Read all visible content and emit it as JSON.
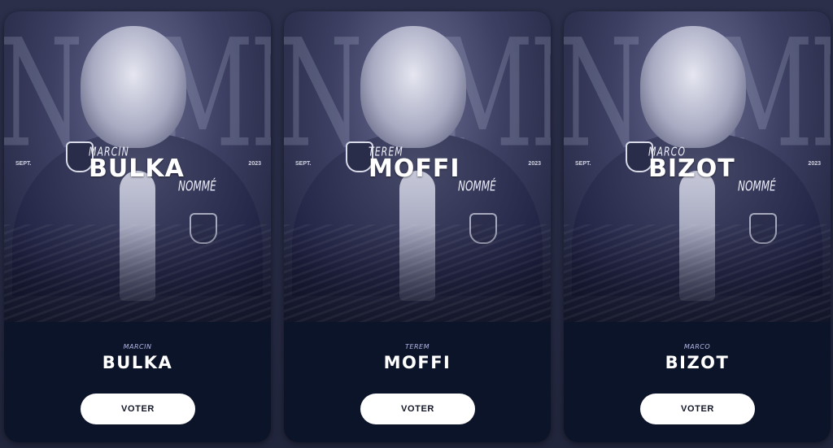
{
  "cards": [
    {
      "poster": {
        "background_word": "NOMMÉ",
        "first_name": "MARCIN",
        "last_name": "BULKA",
        "tag": "NOMMÉ",
        "month": "SEPT.",
        "year": "2023"
      },
      "first_name": "MARCIN",
      "last_name": "BULKA",
      "vote_label": "VOTER"
    },
    {
      "poster": {
        "background_word": "NOMMÉ",
        "first_name": "TEREM",
        "last_name": "MOFFI",
        "tag": "NOMMÉ",
        "month": "SEPT.",
        "year": "2023"
      },
      "first_name": "TEREM",
      "last_name": "MOFFI",
      "vote_label": "VOTER"
    },
    {
      "poster": {
        "background_word": "NOMMÉ",
        "first_name": "MARCO",
        "last_name": "BIZOT",
        "tag": "NOMMÉ",
        "month": "SEPT.",
        "year": "2023"
      },
      "first_name": "MARCO",
      "last_name": "BIZOT",
      "vote_label": "VOTER"
    }
  ],
  "colors": {
    "page_background": "#262a42",
    "card_background": "#0c1429",
    "first_name_accent": "#b3b7e6",
    "button_background": "#ffffff"
  }
}
